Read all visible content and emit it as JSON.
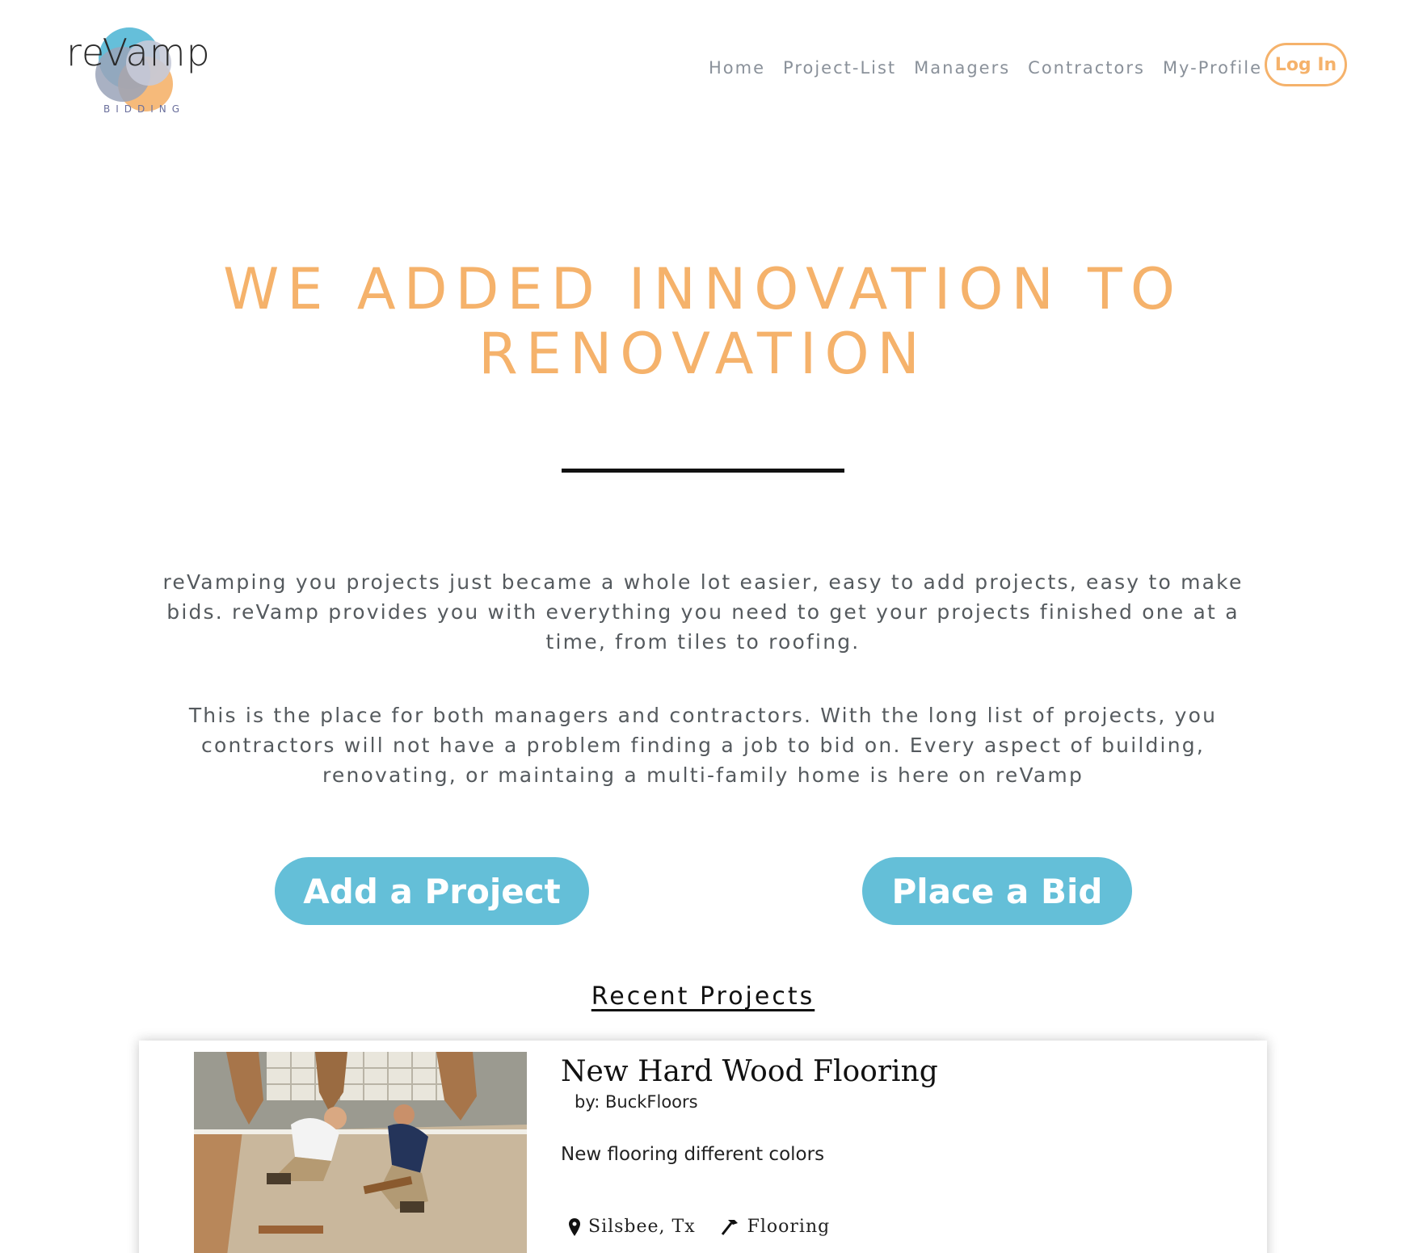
{
  "header": {
    "logo_text": "reVamp",
    "logo_subtext": "BIDDING",
    "nav": [
      {
        "label": "Home"
      },
      {
        "label": "Project-List"
      },
      {
        "label": "Managers"
      },
      {
        "label": "Contractors"
      },
      {
        "label": "My-Profile"
      }
    ],
    "login_label": "Log In"
  },
  "hero": {
    "title_line1": "WE ADDED INNOVATION TO",
    "title_line2": "RENOVATION",
    "paragraph1": "reVamping you projects just became a whole lot easier, easy to add projects, easy to make bids. reVamp provides you with everything you need to get your projects finished one at a time, from tiles to roofing.",
    "paragraph2": "This is the place for both managers and contractors. With the long list of projects, you contractors will not have a problem finding a job to bid on. Every aspect of building, renovating, or maintaing a multi-family home is here on reVamp"
  },
  "actions": {
    "add_project_label": "Add a Project",
    "place_bid_label": "Place a Bid"
  },
  "recent": {
    "heading": "Recent Projects",
    "projects": [
      {
        "title": "New Hard Wood Flooring",
        "by": "by: BuckFloors",
        "description": "New flooring different colors",
        "location": "Silsbee, Tx",
        "category": "Flooring",
        "location_icon": "map-pin-icon",
        "category_icon": "hammer-icon"
      }
    ]
  },
  "colors": {
    "accent_orange": "#f5b26b",
    "button_blue": "#64bfd8",
    "nav_gray": "#8a919a",
    "body_text": "#555a5e"
  }
}
